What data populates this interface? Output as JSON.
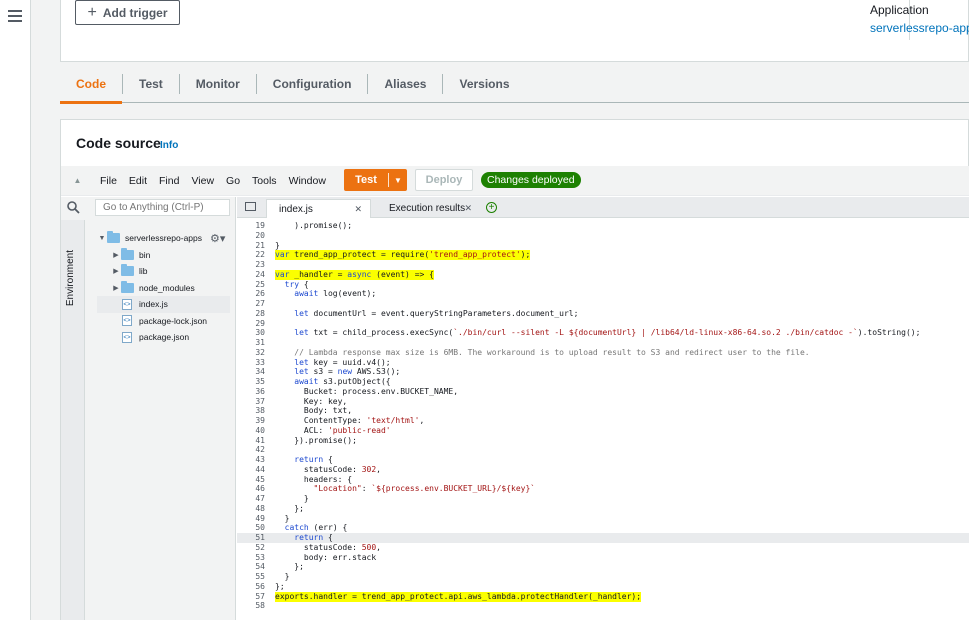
{
  "top": {
    "add_trigger_label": "Add trigger",
    "application_label": "Application",
    "application_link": "serverlessrepo-appse"
  },
  "tabs": [
    "Code",
    "Test",
    "Monitor",
    "Configuration",
    "Aliases",
    "Versions"
  ],
  "active_tab": "Code",
  "code_source": {
    "title": "Code source",
    "info": "Info"
  },
  "ide": {
    "menu": [
      "File",
      "Edit",
      "Find",
      "View",
      "Go",
      "Tools",
      "Window"
    ],
    "test_button": "Test",
    "deploy_button": "Deploy",
    "status_badge": "Changes deployed",
    "search_placeholder": "Go to Anything (Ctrl-P)",
    "environment_label": "Environment",
    "tree": [
      {
        "type": "folder",
        "name": "serverlessrepo-apps",
        "open": true,
        "depth": 0
      },
      {
        "type": "folder",
        "name": "bin",
        "open": false,
        "depth": 1
      },
      {
        "type": "folder",
        "name": "lib",
        "open": false,
        "depth": 1
      },
      {
        "type": "folder",
        "name": "node_modules",
        "open": false,
        "depth": 1
      },
      {
        "type": "file",
        "name": "index.js",
        "depth": 1,
        "selected": true
      },
      {
        "type": "file",
        "name": "package-lock.json",
        "depth": 1
      },
      {
        "type": "file",
        "name": "package.json",
        "depth": 1
      }
    ],
    "file_tabs": [
      {
        "name": "index.js",
        "active": true
      },
      {
        "name": "Execution results",
        "active": false
      }
    ],
    "code_lines": [
      {
        "n": "19",
        "t": "    ).promise();"
      },
      {
        "n": "20",
        "t": ""
      },
      {
        "n": "21",
        "t": "}"
      },
      {
        "n": "22",
        "t": "var trend_app_protect = require('trend_app_protect');",
        "hl": true
      },
      {
        "n": "23",
        "t": ""
      },
      {
        "n": "24",
        "t": "var _handler = async (event) => {",
        "hl": true
      },
      {
        "n": "25",
        "t": "  try {"
      },
      {
        "n": "26",
        "t": "    await log(event);"
      },
      {
        "n": "27",
        "t": ""
      },
      {
        "n": "28",
        "t": "    let documentUrl = event.queryStringParameters.document_url;"
      },
      {
        "n": "29",
        "t": ""
      },
      {
        "n": "30",
        "t": "    let txt = child_process.execSync(`./bin/curl --silent -L ${documentUrl} | /lib64/ld-linux-x86-64.so.2 ./bin/catdoc -`).toString();"
      },
      {
        "n": "31",
        "t": ""
      },
      {
        "n": "32",
        "t": "    // Lambda response max size is 6MB. The workaround is to upload result to S3 and redirect user to the file."
      },
      {
        "n": "33",
        "t": "    let key = uuid.v4();"
      },
      {
        "n": "34",
        "t": "    let s3 = new AWS.S3();"
      },
      {
        "n": "35",
        "t": "    await s3.putObject({"
      },
      {
        "n": "36",
        "t": "      Bucket: process.env.BUCKET_NAME,"
      },
      {
        "n": "37",
        "t": "      Key: key,"
      },
      {
        "n": "38",
        "t": "      Body: txt,"
      },
      {
        "n": "39",
        "t": "      ContentType: 'text/html',"
      },
      {
        "n": "40",
        "t": "      ACL: 'public-read'"
      },
      {
        "n": "41",
        "t": "    }).promise();"
      },
      {
        "n": "42",
        "t": ""
      },
      {
        "n": "43",
        "t": "    return {"
      },
      {
        "n": "44",
        "t": "      statusCode: 302,"
      },
      {
        "n": "45",
        "t": "      headers: {"
      },
      {
        "n": "46",
        "t": "        \"Location\": `${process.env.BUCKET_URL}/${key}`"
      },
      {
        "n": "47",
        "t": "      }"
      },
      {
        "n": "48",
        "t": "    };"
      },
      {
        "n": "49",
        "t": "  }"
      },
      {
        "n": "50",
        "t": "  catch (err) {"
      },
      {
        "n": "51",
        "t": "    return {",
        "cursor": true
      },
      {
        "n": "52",
        "t": "      statusCode: 500,"
      },
      {
        "n": "53",
        "t": "      body: err.stack"
      },
      {
        "n": "54",
        "t": "    };"
      },
      {
        "n": "55",
        "t": "  }"
      },
      {
        "n": "56",
        "t": "};"
      },
      {
        "n": "57",
        "t": "exports.handler = trend_app_protect.api.aws_lambda.protectHandler(_handler);",
        "hl": true
      },
      {
        "n": "58",
        "t": ""
      }
    ]
  },
  "colors": {
    "accent": "#ec7211",
    "link": "#0073bb",
    "success": "#1d8102",
    "highlight": "#fbff00"
  }
}
